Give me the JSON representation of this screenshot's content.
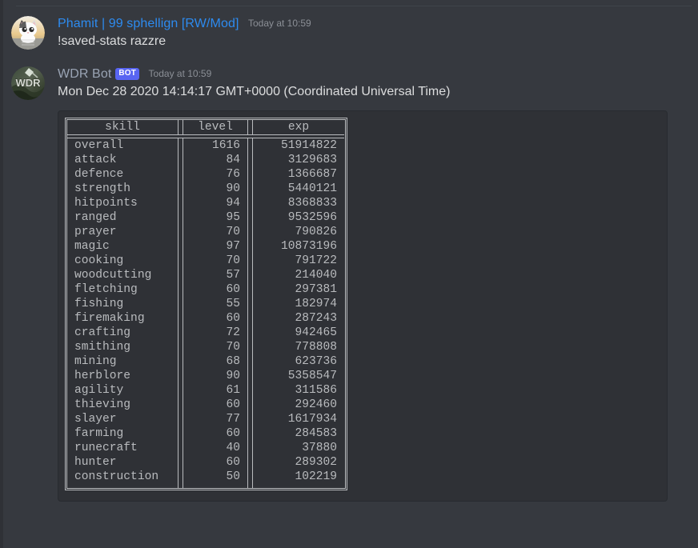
{
  "messages": [
    {
      "author": "Phamit | 99 sphellign [RW/Mod]",
      "is_bot": false,
      "bot_tag": "BOT",
      "timestamp": "Today at 10:59",
      "text": "!saved-stats razzre",
      "avatar_name": "cat-avatar"
    },
    {
      "author": "WDR Bot",
      "is_bot": true,
      "bot_tag": "BOT",
      "timestamp": "Today at 10:59",
      "text": "Mon Dec 28 2020 14:14:17 GMT+0000 (Coordinated Universal Time)",
      "avatar_name": "wdr-bot-avatar"
    }
  ],
  "stats_table": {
    "columns": [
      "skill",
      "level",
      "exp"
    ],
    "rows": [
      [
        "overall",
        "1616",
        "51914822"
      ],
      [
        "attack",
        "84",
        "3129683"
      ],
      [
        "defence",
        "76",
        "1366687"
      ],
      [
        "strength",
        "90",
        "5440121"
      ],
      [
        "hitpoints",
        "94",
        "8368833"
      ],
      [
        "ranged",
        "95",
        "9532596"
      ],
      [
        "prayer",
        "70",
        "790826"
      ],
      [
        "magic",
        "97",
        "10873196"
      ],
      [
        "cooking",
        "70",
        "791722"
      ],
      [
        "woodcutting",
        "57",
        "214040"
      ],
      [
        "fletching",
        "60",
        "297381"
      ],
      [
        "fishing",
        "55",
        "182974"
      ],
      [
        "firemaking",
        "60",
        "287243"
      ],
      [
        "crafting",
        "72",
        "942465"
      ],
      [
        "smithing",
        "70",
        "778808"
      ],
      [
        "mining",
        "68",
        "623736"
      ],
      [
        "herblore",
        "90",
        "5358547"
      ],
      [
        "agility",
        "61",
        "311586"
      ],
      [
        "thieving",
        "60",
        "292460"
      ],
      [
        "slayer",
        "77",
        "1617934"
      ],
      [
        "farming",
        "60",
        "284583"
      ],
      [
        "runecraft",
        "40",
        "37880"
      ],
      [
        "hunter",
        "60",
        "289302"
      ],
      [
        "construction",
        "50",
        "102219"
      ]
    ]
  },
  "colors": {
    "app_background": "#36393f",
    "codeblock_background": "#2f3136",
    "user_name": "#2d8bf0",
    "bot_name": "#9aa4b4",
    "bot_tag_background": "#5865f2",
    "message_text": "#dcddde",
    "code_text": "#b9bbbe",
    "timestamp": "#8b8f96"
  }
}
